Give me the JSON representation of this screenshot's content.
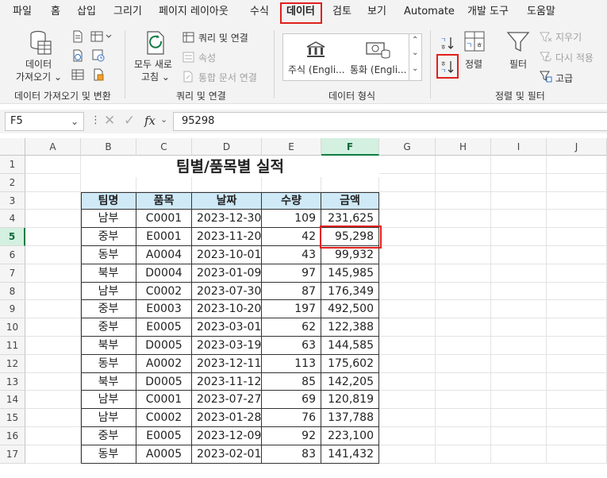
{
  "menu": {
    "tabs": [
      "파일",
      "홈",
      "삽입",
      "그리기",
      "페이지 레이아웃",
      "수식",
      "데이터",
      "검토",
      "보기",
      "Automate",
      "개발 도구",
      "도움말"
    ],
    "active": "데이터"
  },
  "ribbon": {
    "get_data": {
      "button_line1": "데이터",
      "button_line2": "가져오기",
      "label": "데이터 가져오기 및 변환"
    },
    "queries": {
      "refresh_line1": "모두 새로",
      "refresh_line2": "고침",
      "queries_connections": "쿼리 및 연결",
      "properties": "속성",
      "edit_links": "통합 문서 연결",
      "label": "쿼리 및 연결"
    },
    "data_types": {
      "stocks": "주식 (Engli...",
      "currencies": "통화 (Engli...",
      "label": "데이터 형식"
    },
    "sort_filter": {
      "sort": "정렬",
      "filter": "필터",
      "clear": "지우기",
      "reapply": "다시 적용",
      "advanced": "고급",
      "label": "정렬 및 필터"
    }
  },
  "formula_bar": {
    "name_box": "F5",
    "fx": "fx",
    "value": "95298"
  },
  "sheet": {
    "columns": [
      "A",
      "B",
      "C",
      "D",
      "E",
      "F",
      "G",
      "H",
      "I",
      "J"
    ],
    "selected_column": "F",
    "selected_row": 5,
    "rows": [
      "1",
      "2",
      "3",
      "4",
      "5",
      "6",
      "7",
      "8",
      "9",
      "10",
      "11",
      "12",
      "13",
      "14",
      "15",
      "16",
      "17"
    ],
    "title": "팀별/품목별 실적",
    "table_headers": [
      "팀명",
      "품목",
      "날짜",
      "수량",
      "금액"
    ],
    "table_rows": [
      [
        "남부",
        "C0001",
        "2023-12-30",
        "109",
        "231,625"
      ],
      [
        "중부",
        "E0001",
        "2023-11-20",
        "42",
        "95,298"
      ],
      [
        "동부",
        "A0004",
        "2023-10-01",
        "43",
        "99,932"
      ],
      [
        "북부",
        "D0004",
        "2023-01-09",
        "97",
        "145,985"
      ],
      [
        "남부",
        "C0002",
        "2023-07-30",
        "87",
        "176,349"
      ],
      [
        "중부",
        "E0003",
        "2023-10-20",
        "197",
        "492,500"
      ],
      [
        "중부",
        "E0005",
        "2023-03-01",
        "62",
        "122,388"
      ],
      [
        "북부",
        "D0005",
        "2023-03-19",
        "63",
        "144,585"
      ],
      [
        "동부",
        "A0002",
        "2023-12-11",
        "113",
        "175,602"
      ],
      [
        "북부",
        "D0005",
        "2023-11-12",
        "85",
        "142,205"
      ],
      [
        "남부",
        "C0001",
        "2023-07-27",
        "69",
        "120,819"
      ],
      [
        "남부",
        "C0002",
        "2023-01-28",
        "76",
        "137,788"
      ],
      [
        "중부",
        "E0005",
        "2023-12-09",
        "92",
        "223,100"
      ],
      [
        "동부",
        "A0005",
        "2023-02-01",
        "83",
        "141,432"
      ]
    ]
  },
  "colors": {
    "accent_green": "#107c41",
    "highlight_red": "#e0201c",
    "table_header_fill": "#cfe9f7"
  }
}
